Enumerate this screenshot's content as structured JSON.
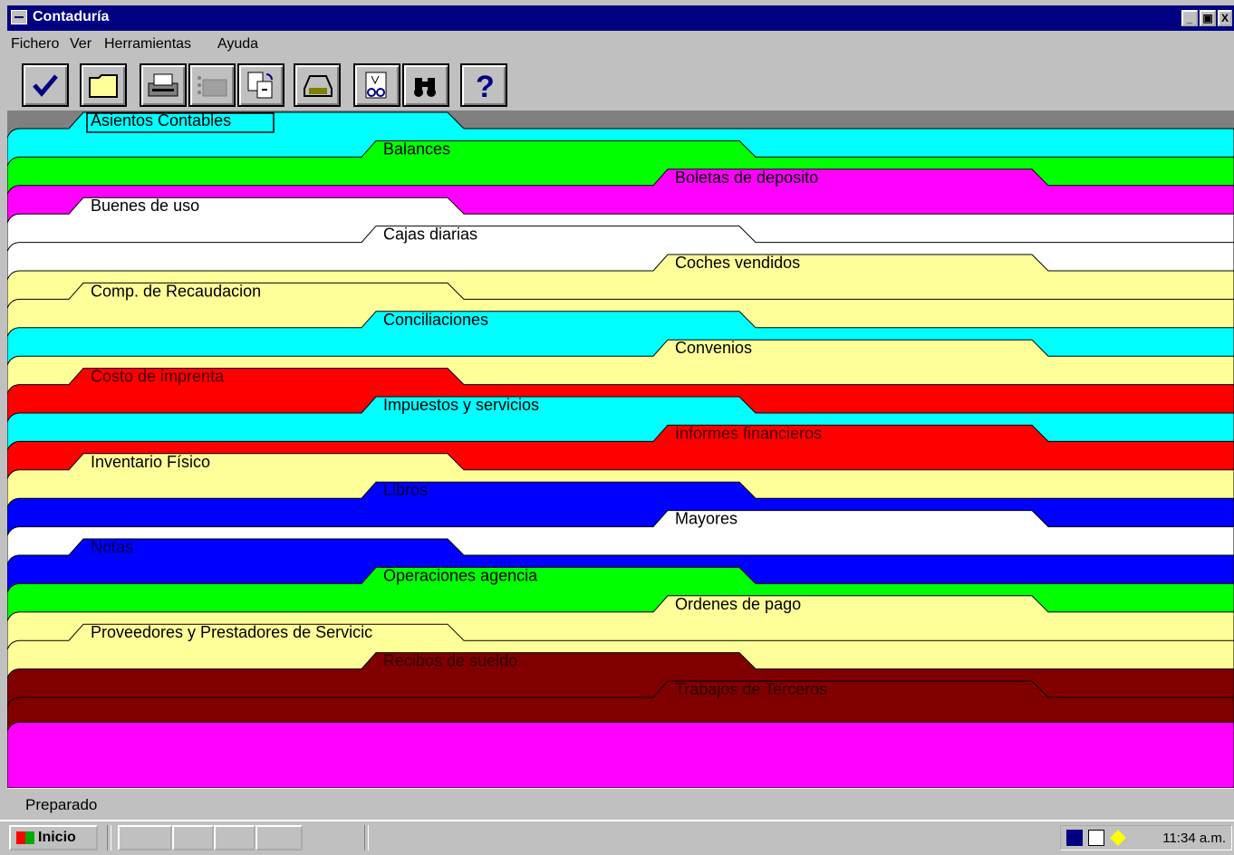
{
  "window": {
    "title": "Contaduría"
  },
  "menu": [
    {
      "label": "Fichero"
    },
    {
      "label": "Ver"
    },
    {
      "label": "Herramientas"
    },
    {
      "label": "Ayuda"
    }
  ],
  "toolbar": {
    "buttons": [
      {
        "icon": "checkmark-icon"
      },
      {
        "icon": "folder-icon"
      },
      {
        "icon": "printer-icon"
      },
      {
        "icon": "fax-icon"
      },
      {
        "icon": "page-refresh-icon"
      },
      {
        "icon": "tray-xn-icon"
      },
      {
        "icon": "document-preview-icon"
      },
      {
        "icon": "binoculars-icon"
      },
      {
        "icon": "help-icon"
      }
    ]
  },
  "tabs": [
    {
      "label": "Asientos Contables",
      "color": "#00ffff"
    },
    {
      "label": "Balances",
      "color": "#00ff00"
    },
    {
      "label": "Boletas de deposito",
      "color": "#ff00ff"
    },
    {
      "label": "Buenes de uso",
      "color": "#ffffff"
    },
    {
      "label": "Cajas diarias",
      "color": "#ffffff"
    },
    {
      "label": "Coches vendidos",
      "color": "#ffff99"
    },
    {
      "label": "Comp. de Recaudacion",
      "color": "#ffff99"
    },
    {
      "label": "Conciliaciones",
      "color": "#00ffff"
    },
    {
      "label": "Convenios",
      "color": "#ffff99"
    },
    {
      "label": "Costo de imprenta",
      "color": "#ff0000"
    },
    {
      "label": "Impuestos y servicios",
      "color": "#00ffff"
    },
    {
      "label": "Informes financieros",
      "color": "#ff0000"
    },
    {
      "label": "Inventario Físico",
      "color": "#ffff99"
    },
    {
      "label": "Libros",
      "color": "#0000ff"
    },
    {
      "label": "Mayores",
      "color": "#ffffff"
    },
    {
      "label": "Notas",
      "color": "#0000ff"
    },
    {
      "label": "Operaciones agencia",
      "color": "#00ff00"
    },
    {
      "label": "Ordenes de pago",
      "color": "#ffff99"
    },
    {
      "label": "Proveedores y Prestadores de Servicic",
      "color": "#ffff99"
    },
    {
      "label": "Recibos de sueldo",
      "color": "#800000"
    },
    {
      "label": "Trabajos de Terceros",
      "color": "#800000"
    }
  ],
  "content_color": "#ff00ff",
  "status": {
    "text": "Preparado"
  },
  "taskbar": {
    "start_label": "Inicio",
    "clock": "11:34 a.m."
  }
}
